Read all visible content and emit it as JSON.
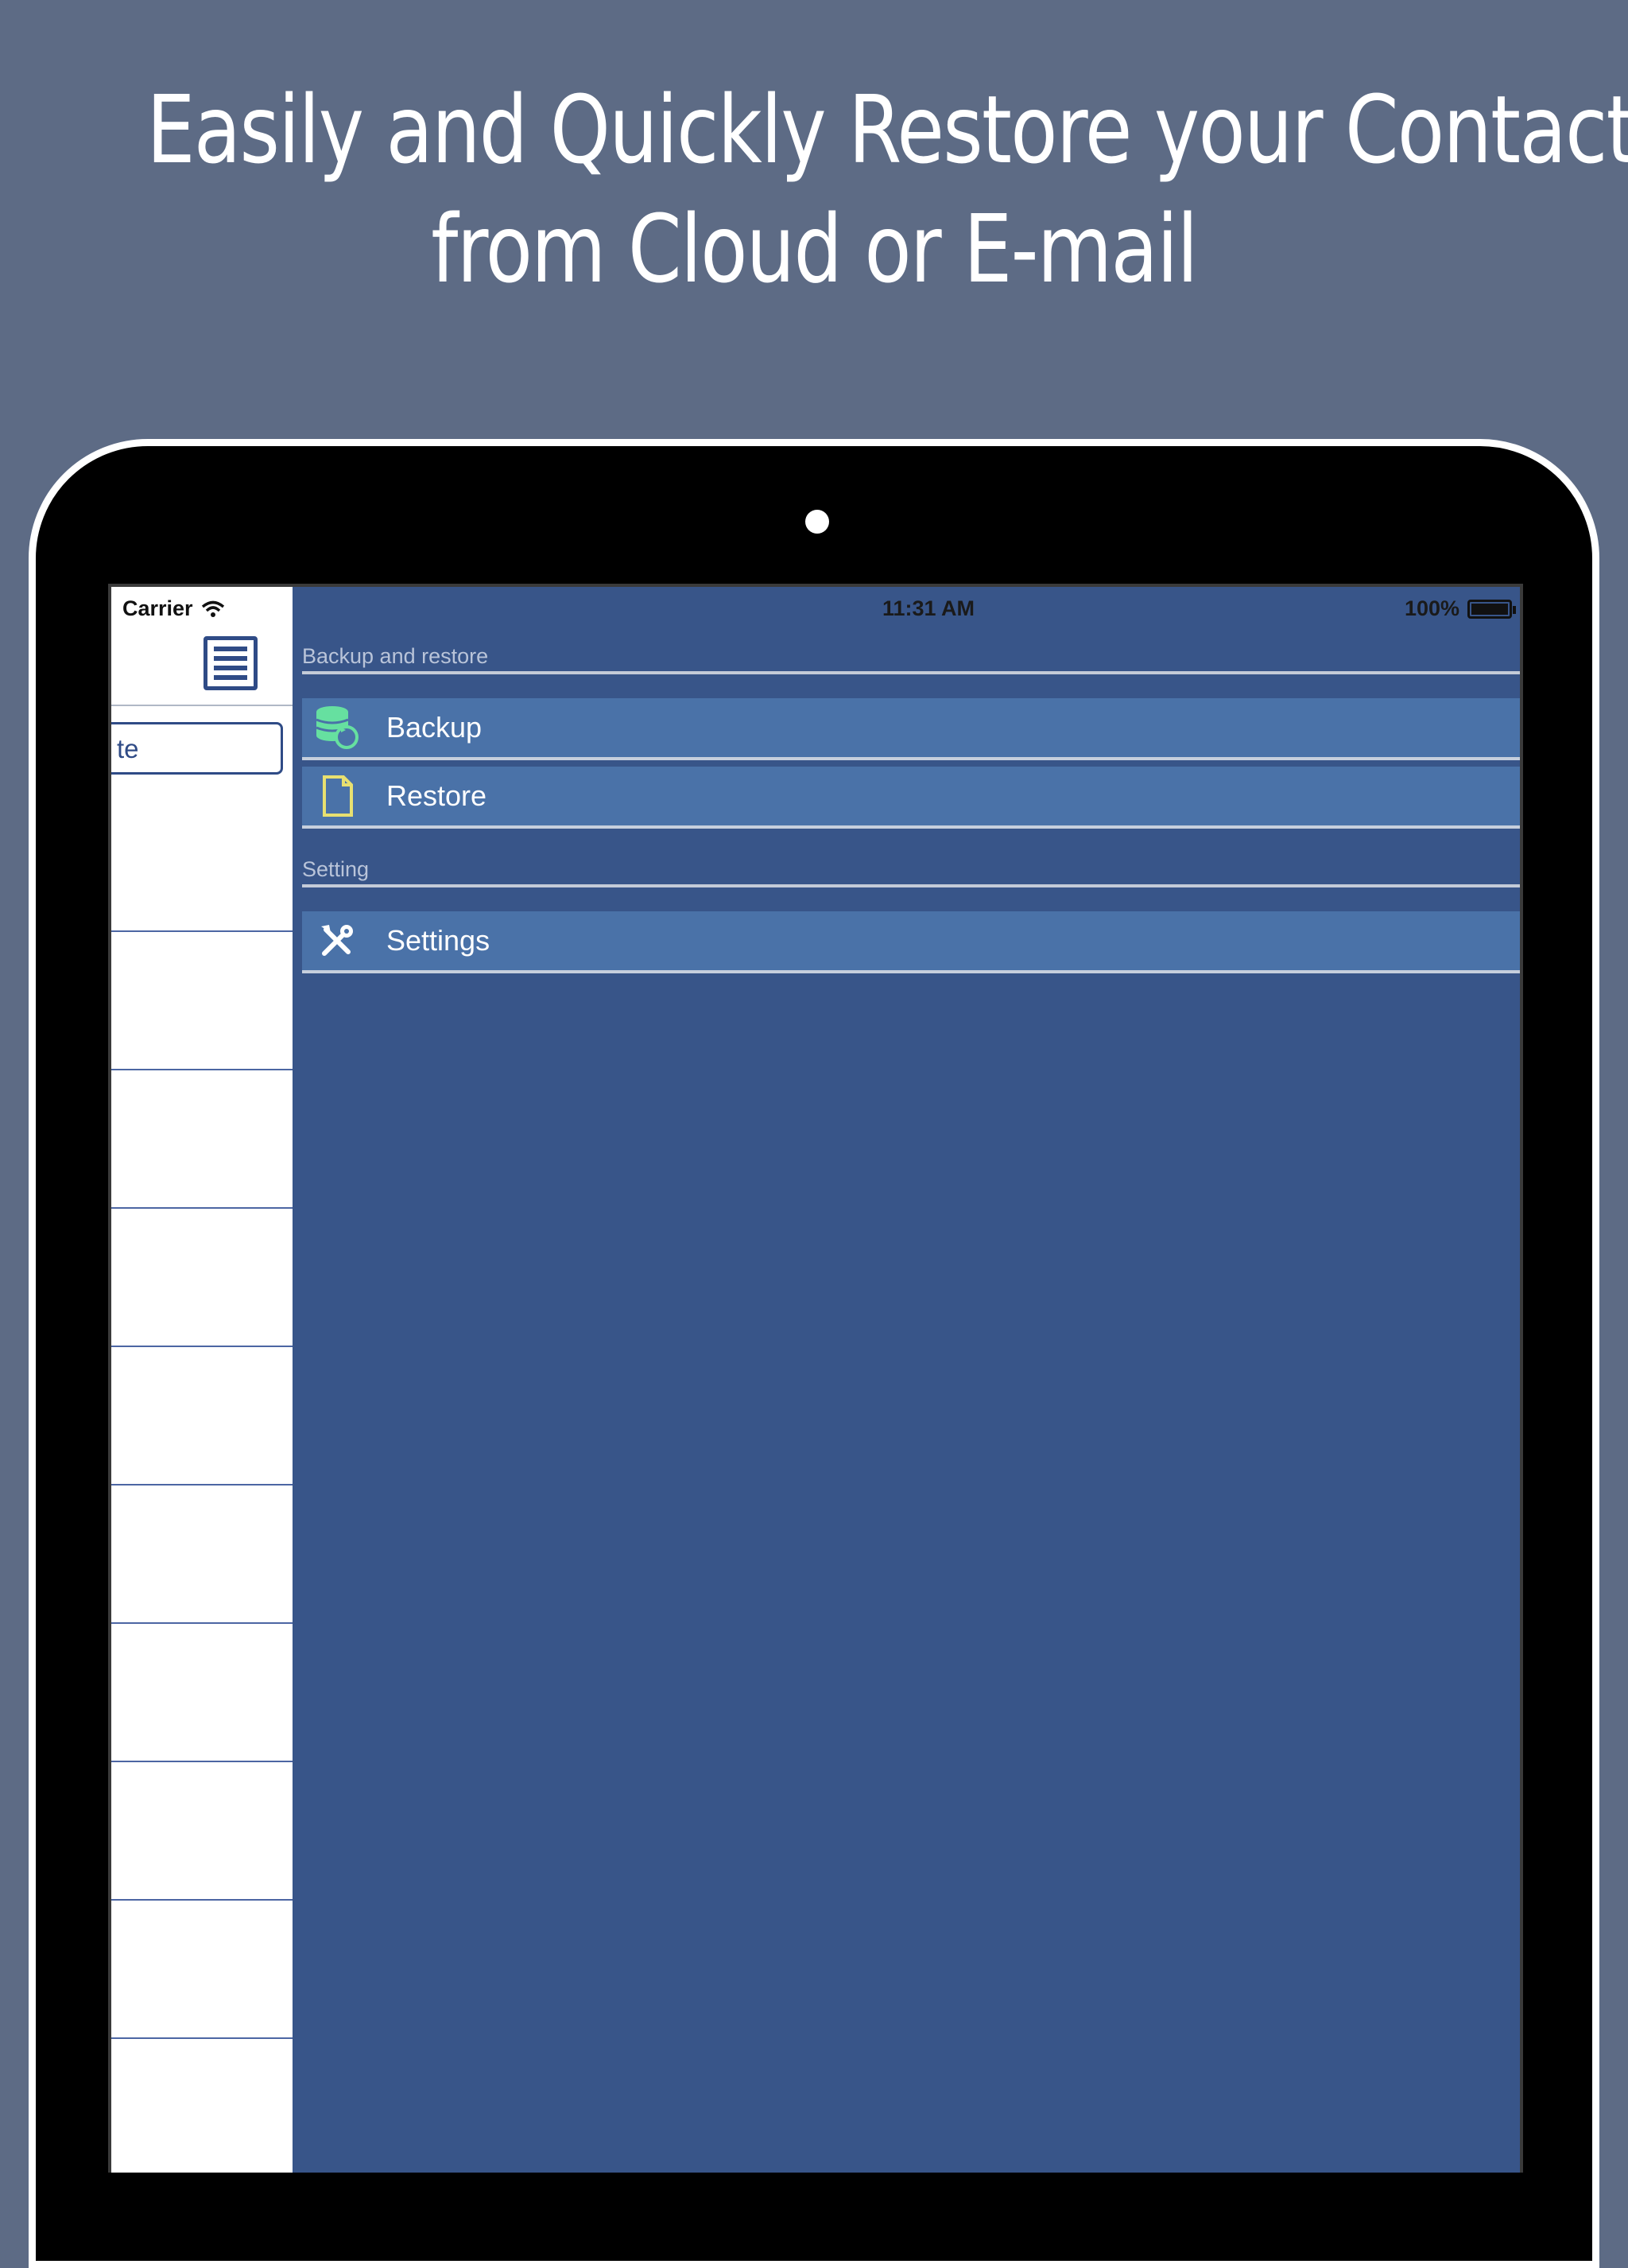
{
  "headline": {
    "line1": "Easily and Quickly Restore your Contacts",
    "line2": "from Cloud or E-mail"
  },
  "status_bar": {
    "carrier": "Carrier",
    "time": "11:31 AM",
    "battery": "100%"
  },
  "left_panel": {
    "search_value": "te"
  },
  "menu": {
    "section1_title": "Backup and restore",
    "items": [
      {
        "label": "Backup",
        "icon": "database-refresh-icon"
      },
      {
        "label": "Restore",
        "icon": "document-icon"
      }
    ],
    "section2_title": "Setting",
    "settings_item": {
      "label": "Settings",
      "icon": "tools-icon"
    }
  },
  "colors": {
    "page_background": "#5d6b85",
    "menu_background": "#385589",
    "menu_row": "#4a72a8",
    "backup_icon": "#66e0a0",
    "restore_icon": "#e8e070"
  }
}
